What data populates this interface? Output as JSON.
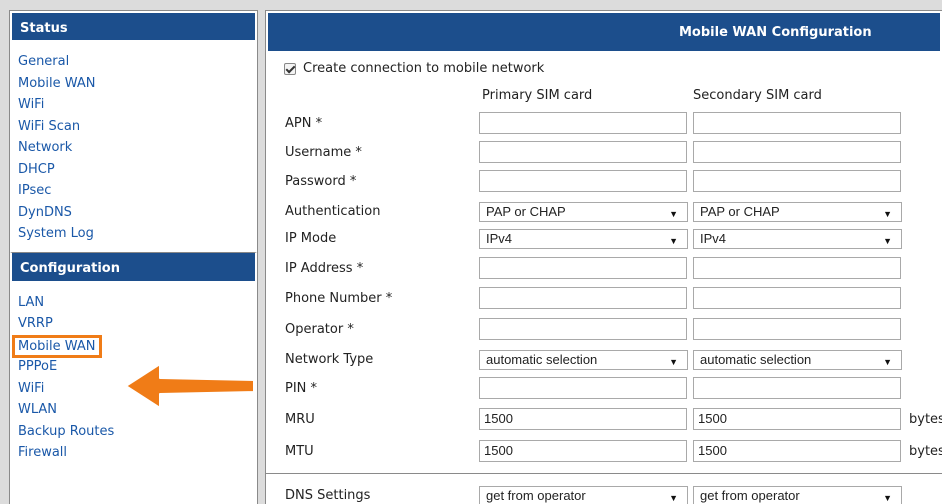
{
  "sidebar": {
    "status_heading": "Status",
    "status_items": [
      "General",
      "Mobile WAN",
      "WiFi",
      "WiFi Scan",
      "Network",
      "DHCP",
      "IPsec",
      "DynDNS",
      "System Log"
    ],
    "config_heading": "Configuration",
    "config_items": [
      "LAN",
      "VRRP",
      "Mobile WAN",
      "PPPoE",
      "WiFi",
      "WLAN",
      "Backup Routes",
      "Firewall"
    ],
    "active_item": "Mobile WAN"
  },
  "main": {
    "title": "Mobile WAN Configuration",
    "create_connection_label": "Create connection to mobile network",
    "create_connection_checked": true,
    "primary_header": "Primary SIM card",
    "secondary_header": "Secondary SIM card",
    "fields": {
      "apn": {
        "label": "APN *",
        "primary": "",
        "secondary": ""
      },
      "username": {
        "label": "Username *",
        "primary": "",
        "secondary": ""
      },
      "password": {
        "label": "Password *",
        "primary": "",
        "secondary": ""
      },
      "authentication": {
        "label": "Authentication",
        "primary": "PAP or CHAP",
        "secondary": "PAP or CHAP"
      },
      "ip_mode": {
        "label": "IP Mode",
        "primary": "IPv4",
        "secondary": "IPv4"
      },
      "ip_address": {
        "label": "IP Address *",
        "primary": "",
        "secondary": ""
      },
      "phone_number": {
        "label": "Phone Number *",
        "primary": "",
        "secondary": ""
      },
      "operator": {
        "label": "Operator *",
        "primary": "",
        "secondary": ""
      },
      "network_type": {
        "label": "Network Type",
        "primary": "automatic selection",
        "secondary": "automatic selection"
      },
      "pin": {
        "label": "PIN *",
        "primary": "",
        "secondary": ""
      },
      "mru": {
        "label": "MRU",
        "primary": "1500",
        "secondary": "1500",
        "unit": "bytes"
      },
      "mtu": {
        "label": "MTU",
        "primary": "1500",
        "secondary": "1500",
        "unit": "bytes"
      },
      "dns_settings": {
        "label": "DNS Settings",
        "primary": "get from operator",
        "secondary": "get from operator"
      }
    }
  },
  "colors": {
    "header_bg": "#1c4e8c",
    "link": "#1a58a8",
    "highlight": "#f07c17"
  },
  "icons": {
    "arrow": "left-arrow-icon",
    "dropdown": "chevron-down-icon",
    "checkbox": "checkbox-checked-icon"
  }
}
